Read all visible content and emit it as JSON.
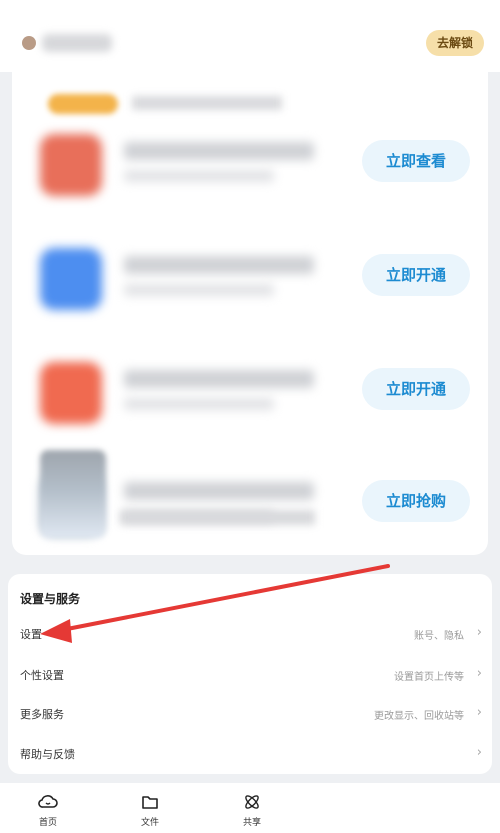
{
  "header": {
    "unlock_label": "去解锁"
  },
  "offers": [
    {
      "button_label": "立即查看",
      "thumb_color": "#e86f5a"
    },
    {
      "button_label": "立即开通",
      "thumb_color": "#4d8ef0"
    },
    {
      "button_label": "立即开通",
      "thumb_color": "#f06a50"
    },
    {
      "button_label": "立即抢购",
      "thumb_color": "#c5ced8"
    }
  ],
  "settings": {
    "title": "设置与服务",
    "rows": [
      {
        "label": "设置",
        "right": "账号、隐私"
      },
      {
        "label": "个性设置",
        "right": "设置首页上传等"
      },
      {
        "label": "更多服务",
        "right": "更改显示、回收站等"
      },
      {
        "label": "帮助与反馈",
        "right": ""
      }
    ]
  },
  "bottom_nav": [
    {
      "label": "首页",
      "icon": "cloud-icon"
    },
    {
      "label": "文件",
      "icon": "folder-icon"
    },
    {
      "label": "共享",
      "icon": "atom-icon"
    }
  ],
  "colors": {
    "accent_blue": "#1d8bd1",
    "unlock_gold": "#f6dfa9",
    "annotation_red": "#e53935"
  }
}
